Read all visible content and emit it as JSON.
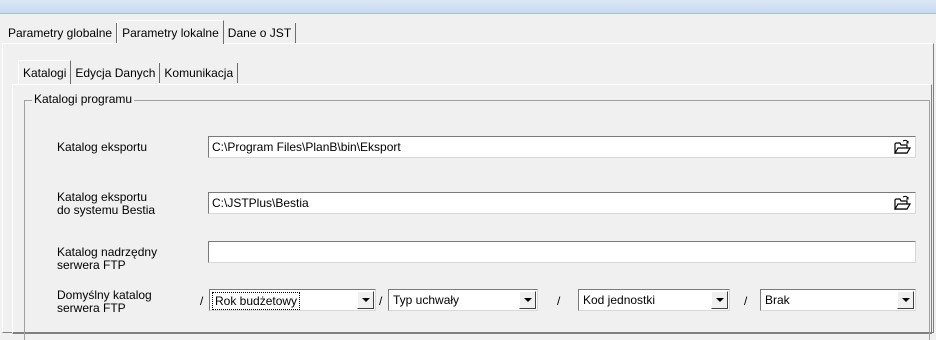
{
  "outer_tabs": [
    {
      "label": "Parametry globalne",
      "active": false
    },
    {
      "label": "Parametry lokalne",
      "active": true
    },
    {
      "label": "Dane o JST",
      "active": false
    }
  ],
  "inner_tabs": [
    {
      "label": "Katalogi",
      "active": true
    },
    {
      "label": "Edycja Danych",
      "active": false
    },
    {
      "label": "Komunikacja",
      "active": false
    }
  ],
  "group": {
    "title": "Katalogi programu",
    "export_dir": {
      "label": "Katalog eksportu",
      "value": "C:\\Program Files\\PlanB\\bin\\Eksport",
      "icon": "folder-open-icon"
    },
    "bestia_dir": {
      "label_line1": "Katalog eksportu",
      "label_line2": "do systemu  Bestia",
      "value": "C:\\JSTPlus\\Bestia",
      "icon": "folder-open-icon"
    },
    "ftp_parent": {
      "label_line1": "Katalog nadrzędny",
      "label_line2": "serwera FTP",
      "value": ""
    },
    "ftp_default": {
      "label_line1": "Domyślny katalog",
      "label_line2": "serwera FTP",
      "separator": "/",
      "combos": [
        {
          "value": "Rok budżetowy"
        },
        {
          "value": "Typ uchwały"
        },
        {
          "value": "Kod jednostki"
        },
        {
          "value": "Brak"
        }
      ]
    }
  }
}
